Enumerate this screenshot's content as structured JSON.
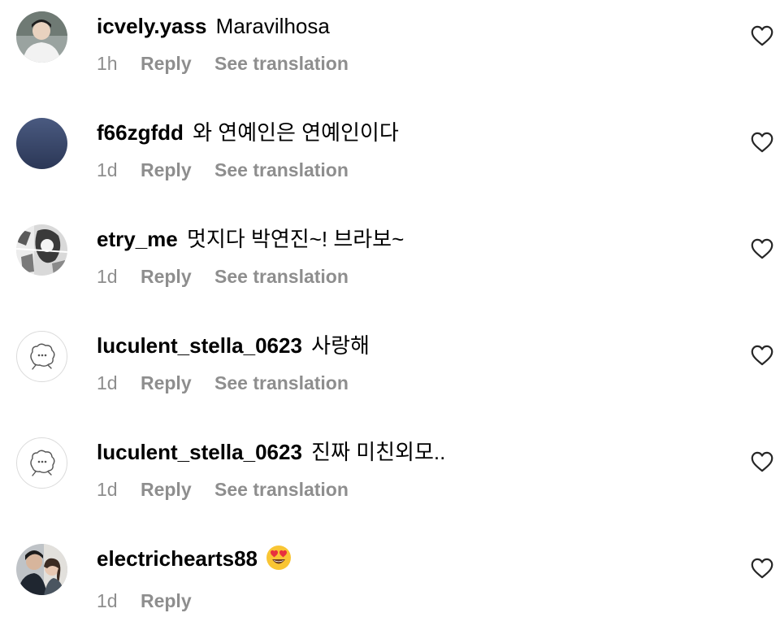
{
  "comments": [
    {
      "username": "icvely.yass",
      "text": "Maravilhosa",
      "time": "1h",
      "reply_label": "Reply",
      "translate_label": "See translation",
      "avatar": "photo-avatar"
    },
    {
      "username": "f66zgfdd",
      "text": "와 연예인은 연예인이다",
      "time": "1d",
      "reply_label": "Reply",
      "translate_label": "See translation",
      "avatar": "photo-avatar"
    },
    {
      "username": "etry_me",
      "text": "멋지다 박연진~! 브라보~",
      "time": "1d",
      "reply_label": "Reply",
      "translate_label": "See translation",
      "avatar": "photo-avatar"
    },
    {
      "username": "luculent_stella_0623",
      "text": "사랑해",
      "time": "1d",
      "reply_label": "Reply",
      "translate_label": "See translation",
      "avatar": "default-avatar"
    },
    {
      "username": "luculent_stella_0623",
      "text": "진짜 미친외모..",
      "time": "1d",
      "reply_label": "Reply",
      "translate_label": "See translation",
      "avatar": "default-avatar"
    },
    {
      "username": "electrichearts88",
      "text": "",
      "emoji": "heart-eyes-emoji",
      "time": "1d",
      "reply_label": "Reply",
      "avatar": "photo-avatar"
    }
  ],
  "icons": {
    "like": "heart-outline-icon",
    "default_avatar": "default-avatar-icon"
  },
  "colors": {
    "text_primary": "#000000",
    "text_secondary": "#8e8e8e",
    "avatar_border": "#dbdbdb",
    "emoji_face": "#f9c534",
    "emoji_hearts": "#e8313f"
  }
}
